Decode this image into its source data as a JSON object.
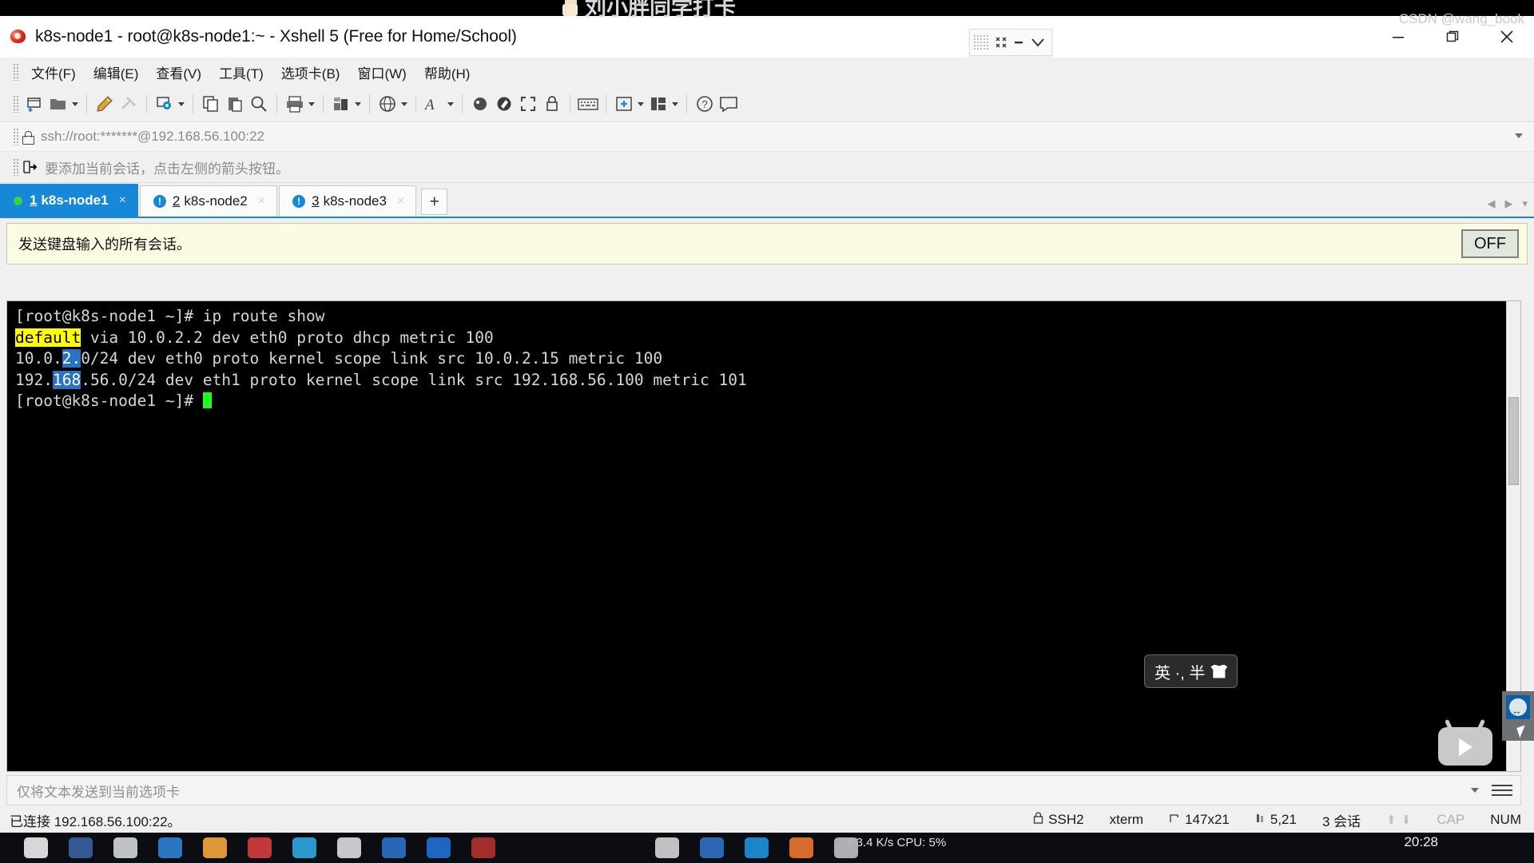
{
  "window": {
    "title": "k8s-node1 - root@k8s-node1:~ - Xshell 5 (Free for Home/School)",
    "minimize_label": "—",
    "maximize_label": "▢",
    "close_label": "✕"
  },
  "watermark": {
    "top_text": "刘小胖同学打卡",
    "bottom_text": "CSDN @wang_book"
  },
  "menu": {
    "items": [
      {
        "label": "文件(F)"
      },
      {
        "label": "编辑(E)"
      },
      {
        "label": "查看(V)"
      },
      {
        "label": "工具(T)"
      },
      {
        "label": "选项卡(B)"
      },
      {
        "label": "窗口(W)"
      },
      {
        "label": "帮助(H)"
      }
    ]
  },
  "toolbar": {
    "items": [
      {
        "name": "new-session-icon",
        "has_caret": false
      },
      {
        "name": "open-folder-icon",
        "has_caret": true
      },
      {
        "name": "edit-pencil-icon",
        "has_caret": false
      },
      {
        "name": "disconnect-icon",
        "has_caret": false
      },
      {
        "name": "properties-gear-icon",
        "has_caret": true
      },
      {
        "name": "copy-session-icon",
        "has_caret": false
      },
      {
        "name": "paste-icon",
        "has_caret": false
      },
      {
        "name": "find-icon",
        "has_caret": false
      },
      {
        "name": "print-icon",
        "has_caret": true
      },
      {
        "name": "transfer-icon",
        "has_caret": true
      },
      {
        "name": "globe-icon",
        "has_caret": true
      },
      {
        "name": "font-icon",
        "has_caret": true
      },
      {
        "name": "log-icon",
        "has_caret": false
      },
      {
        "name": "highlight-icon",
        "has_caret": false
      },
      {
        "name": "fullscreen-icon",
        "has_caret": false
      },
      {
        "name": "lock-icon",
        "has_caret": false
      },
      {
        "name": "keyboard-icon",
        "has_caret": false
      },
      {
        "name": "add-pane-icon",
        "has_caret": true
      },
      {
        "name": "layout-icon",
        "has_caret": true
      },
      {
        "name": "help-icon",
        "has_caret": false
      },
      {
        "name": "chat-icon",
        "has_caret": false
      }
    ]
  },
  "address_bar": {
    "value": "ssh://root:*******@192.168.56.100:22",
    "lock_icon": "lock-icon"
  },
  "hint_bar": {
    "text": "要添加当前会话，点击左侧的箭头按钮。",
    "icon": "add-session-arrow-icon"
  },
  "tabs": {
    "items": [
      {
        "number": "1",
        "label": "k8s-node1",
        "status": "connected",
        "active": true,
        "close": "×"
      },
      {
        "number": "2",
        "label": "k8s-node2",
        "status": "warning",
        "active": false,
        "close": "×"
      },
      {
        "number": "3",
        "label": "k8s-node3",
        "status": "warning",
        "active": false,
        "close": "×"
      }
    ],
    "new_tab_label": "+",
    "warn_glyph": "!"
  },
  "broadcast": {
    "text": "发送键盘输入的所有会话。",
    "toggle_label": "OFF"
  },
  "terminal": {
    "lines": [
      {
        "segments": [
          {
            "text": "[root@k8s-node1 ~]# ip route show",
            "style": "normal"
          }
        ]
      },
      {
        "segments": [
          {
            "text": "default",
            "style": "highlight-yellow"
          },
          {
            "text": " via 10.0.2.2 dev eth0 proto dhcp metric 100",
            "style": "normal"
          }
        ]
      },
      {
        "segments": [
          {
            "text": "10.0.",
            "style": "normal"
          },
          {
            "text": "2.",
            "style": "highlight-blue"
          },
          {
            "text": "0/24 dev eth0 proto kernel scope link src 10.0.2.15 metric 100",
            "style": "normal"
          }
        ]
      },
      {
        "segments": [
          {
            "text": "192.",
            "style": "normal"
          },
          {
            "text": "168",
            "style": "highlight-blue"
          },
          {
            "text": ".56.0/24 dev eth1 proto kernel scope link src 192.168.56.100 metric 101",
            "style": "normal"
          }
        ]
      },
      {
        "segments": [
          {
            "text": "[root@k8s-node1 ~]# ",
            "style": "normal"
          }
        ],
        "cursor": true
      }
    ]
  },
  "ime": {
    "text": "英 ·, 半",
    "icon": "ime-shirt-icon"
  },
  "send_bar": {
    "placeholder": "仅将文本发送到当前选项卡"
  },
  "status_bar": {
    "connection": "已连接 192.168.56.100:22。",
    "protocol": "SSH2",
    "terminal_type": "xterm",
    "size": "147x21",
    "cursor_pos": "5,21",
    "sessions": "3 会话",
    "cap": "CAP",
    "num": "NUM"
  },
  "taskbar": {
    "network": "↑ 3.4 K/s    CPU: 5%",
    "clock": "20:28"
  },
  "colors": {
    "accent": "#1787d8",
    "broadcast_bg": "#fbfbe4",
    "terminal_bg": "#000000",
    "terminal_fg": "#d6d6d6",
    "cursor": "#1dff1d",
    "highlight_yellow": "#ffff00",
    "highlight_blue": "#2a72c4",
    "tab_connected_dot": "#2fd643"
  }
}
